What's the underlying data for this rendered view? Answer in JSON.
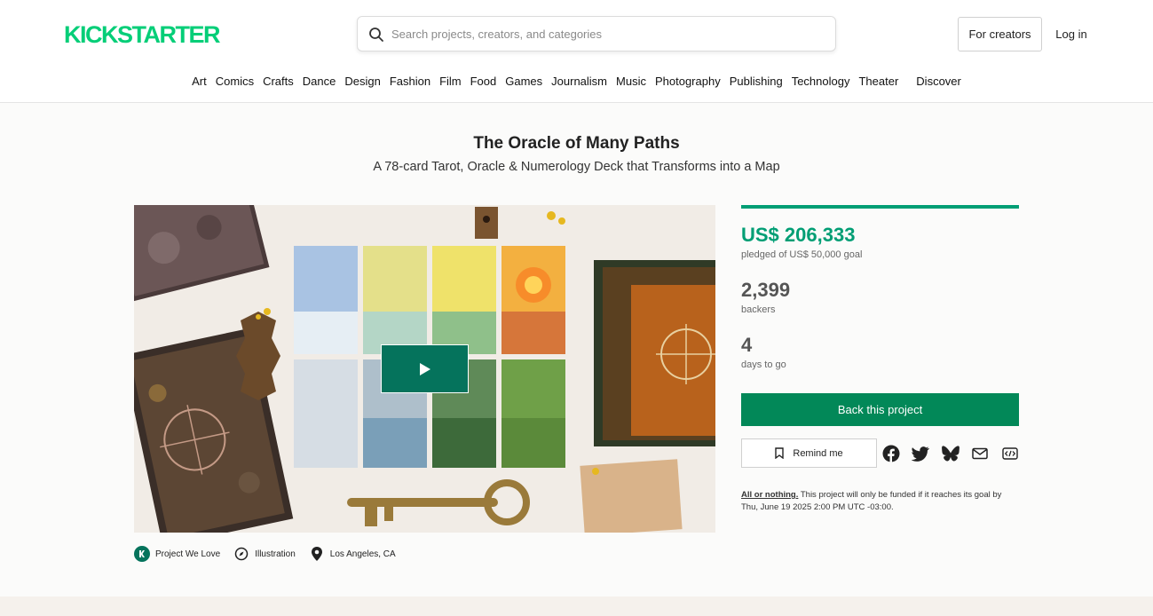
{
  "header": {
    "logo_text": "KICKSTARTER",
    "search": {
      "placeholder": "Search projects, creators, and categories"
    },
    "for_creators": "For creators",
    "login": "Log in",
    "categories": [
      "Art",
      "Comics",
      "Crafts",
      "Dance",
      "Design",
      "Fashion",
      "Film",
      "Food",
      "Games",
      "Journalism",
      "Music",
      "Photography",
      "Publishing",
      "Technology",
      "Theater"
    ],
    "discover": "Discover"
  },
  "project": {
    "title": "The Oracle of Many Paths",
    "subtitle": "A 78-card Tarot, Oracle & Numerology Deck that Transforms into a Map",
    "tags": {
      "pwl": "Project We Love",
      "category": "Illustration",
      "location": "Los Angeles, CA"
    }
  },
  "stats": {
    "funded_fraction": 1.0,
    "pledged": "US$ 206,333",
    "pledged_sub": "pledged of US$ 50,000 goal",
    "backers": "2,399",
    "backers_sub": "backers",
    "days": "4",
    "days_sub": "days to go",
    "back_button": "Back this project",
    "remind_button": "Remind me",
    "share_icons": [
      "facebook-icon",
      "twitter-icon",
      "bluesky-icon",
      "email-icon",
      "embed-icon"
    ],
    "aon_link": "All or nothing.",
    "aon_text": " This project will only be funded if it reaches its goal by Thu, June 19 2025 2:00 PM UTC -03:00."
  },
  "colors": {
    "brand_green": "#05ce78",
    "pledged_green": "#009e74",
    "back_button": "#028858",
    "play_button": "#05735c"
  }
}
